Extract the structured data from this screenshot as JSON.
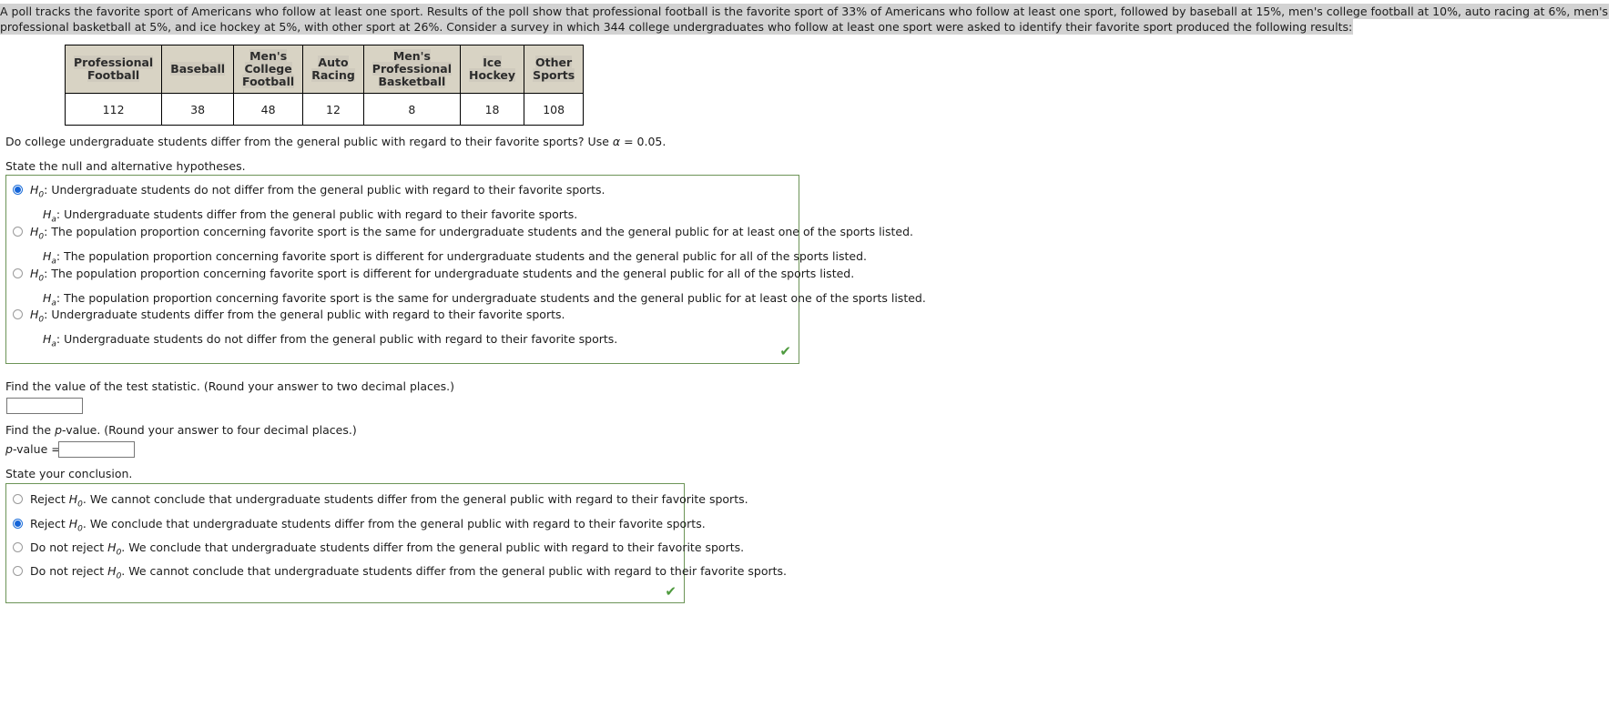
{
  "problem": {
    "text_part_1": "A poll tracks the favorite sport of Americans who follow at least one sport. Results of the poll show that professional football is the favorite sport of 33% of Americans who follow at least one sport, followed by baseball at 15%, men's college football at 10%, auto racing at 6%, men's",
    "text_part_2": "professional basketball at 5%, and ice hockey at 5%, with other sport at 26%. Consider a survey in which 344 college undergraduates who follow at least one sport were asked to identify their favorite sport produced the following results:"
  },
  "table": {
    "headers": [
      "Professional Football",
      "Baseball",
      "Men's College Football",
      "Auto Racing",
      "Men's Professional Basketball",
      "Ice Hockey",
      "Other Sports"
    ],
    "header_lines": [
      [
        "Professional",
        "Football"
      ],
      [
        "Baseball"
      ],
      [
        "Men's",
        "College",
        "Football"
      ],
      [
        "Auto",
        "Racing"
      ],
      [
        "Men's",
        "Professional",
        "Basketball"
      ],
      [
        "Ice",
        "Hockey"
      ],
      [
        "Other",
        "Sports"
      ]
    ],
    "values": [
      "112",
      "38",
      "48",
      "12",
      "8",
      "18",
      "108"
    ]
  },
  "prompts": {
    "question": "Do college undergraduate students differ from the general public with regard to their favorite sports? Use α = 0.05.",
    "hypotheses_label": "State the null and alternative hypotheses.",
    "test_statistic_label": "Find the value of the test statistic. (Round your answer to two decimal places.)",
    "p_value_label_prefix": "Find the ",
    "p_value_label_italic": "p",
    "p_value_label_suffix": "-value. (Round your answer to four decimal places.)",
    "p_value_field_label_italic": "p",
    "p_value_field_label_suffix": "-value =",
    "conclusion_label": "State your conclusion."
  },
  "hypothesis_options": [
    {
      "selected": true,
      "h0": "Undergraduate students do not differ from the general public with regard to their favorite sports.",
      "ha": "Undergraduate students differ from the general public with regard to their favorite sports."
    },
    {
      "selected": false,
      "h0": "The population proportion concerning favorite sport is the same for undergraduate students and the general public for at least one of the sports listed.",
      "ha": "The population proportion concerning favorite sport is different for undergraduate students and the general public for all of the sports listed."
    },
    {
      "selected": false,
      "h0": "The population proportion concerning favorite sport is different for undergraduate students and the general public for all of the sports listed.",
      "ha": "The population proportion concerning favorite sport is the same for undergraduate students and the general public for at least one of the sports listed."
    },
    {
      "selected": false,
      "h0": "Undergraduate students differ from the general public with regard to their favorite sports.",
      "ha": "Undergraduate students do not differ from the general public with regard to their favorite sports."
    }
  ],
  "hypothesis_symbols": {
    "null": "H",
    "null_sub": "0",
    "alt": "H",
    "alt_sub": "a",
    "colon": ":"
  },
  "conclusion_options": [
    {
      "selected": false,
      "action": "Reject",
      "text": ". We cannot conclude that undergraduate students differ from the general public with regard to their favorite sports."
    },
    {
      "selected": true,
      "action": "Reject",
      "text": ". We conclude that undergraduate students differ from the general public with regard to their favorite sports."
    },
    {
      "selected": false,
      "action": "Do not reject",
      "text": ". We conclude that undergraduate students differ from the general public with regard to their favorite sports."
    },
    {
      "selected": false,
      "action": "Do not reject",
      "text": ". We cannot conclude that undergraduate students differ from the general public with regard to their favorite sports."
    }
  ],
  "inputs": {
    "test_statistic_value": "",
    "test_statistic_placeholder": "",
    "p_value_value": "",
    "p_value_placeholder": ""
  },
  "icons": {
    "correct_check": "✔"
  },
  "colors": {
    "answer_box_border": "#6c9457",
    "check_green": "#4e9a3e",
    "radio_selected": "#1565d8",
    "table_header_bg": "#d8d3c4",
    "highlight_bg": "#d2d2d2"
  }
}
